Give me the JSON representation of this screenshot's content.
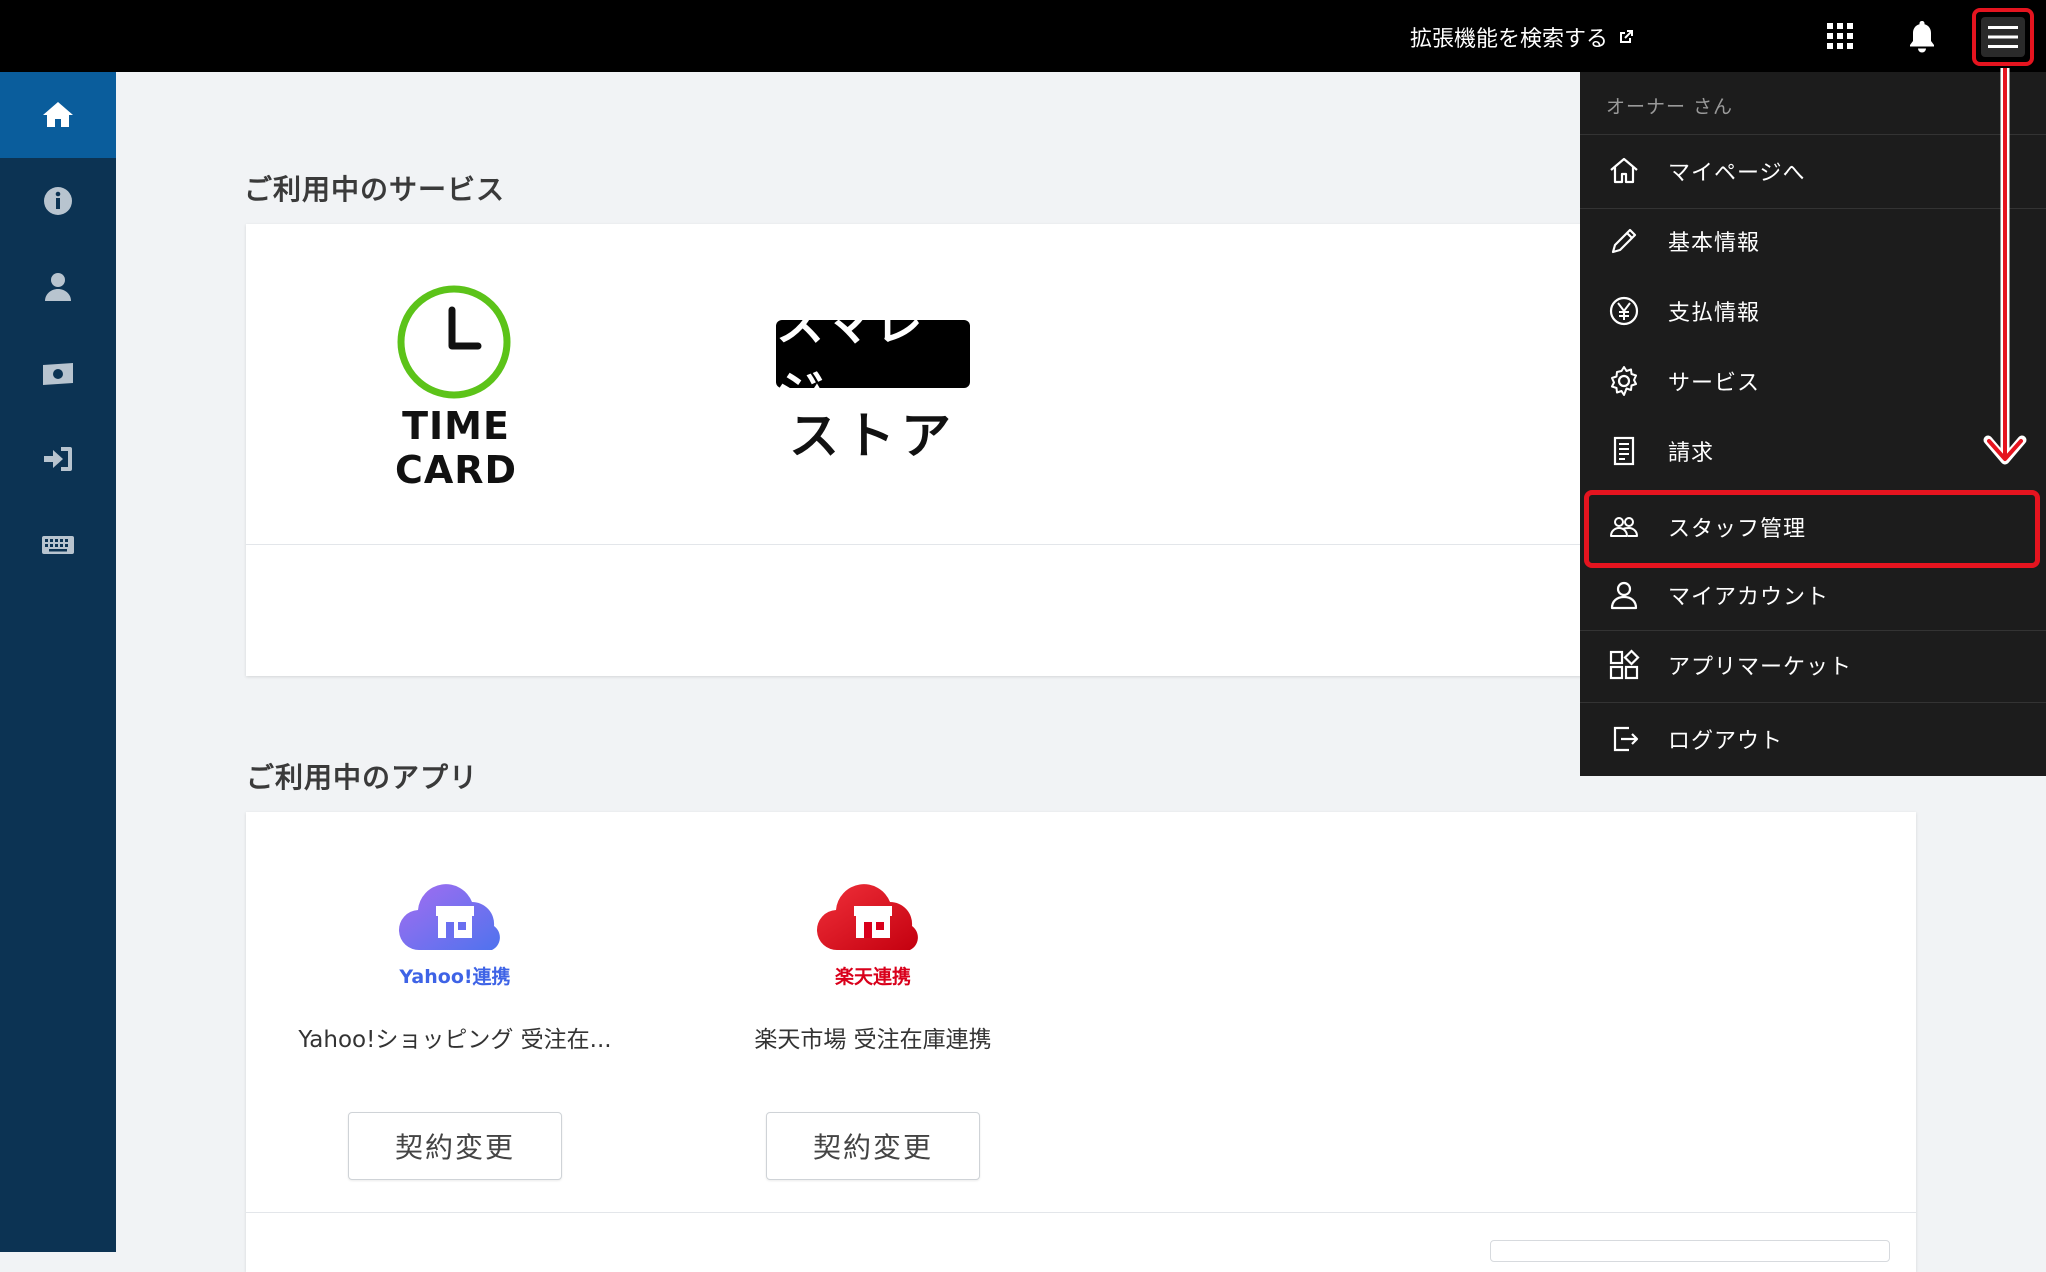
{
  "header": {
    "extension_link": "拡張機能を検索する",
    "icons": {
      "external": "external-link-icon",
      "apps": "apps-grid-icon",
      "bell": "bell-icon",
      "menu": "hamburger-menu-icon"
    }
  },
  "sidebar": {
    "items": [
      {
        "icon": "home-icon",
        "active": true
      },
      {
        "icon": "info-icon",
        "active": false
      },
      {
        "icon": "user-icon",
        "active": false
      },
      {
        "icon": "money-icon",
        "active": false
      },
      {
        "icon": "sign-in-icon",
        "active": false
      },
      {
        "icon": "keyboard-icon",
        "active": false
      }
    ]
  },
  "services": {
    "title": "ご利用中のサービス",
    "timecard_label": "TIME CARD",
    "smaregi_top": "スマレジ",
    "smaregi_bottom": "ストア"
  },
  "apps": {
    "title": "ご利用中のアプリ",
    "items": [
      {
        "logo_label": "Yahoo!連携",
        "name": "Yahoo!ショッピング 受注在...",
        "button": "契約変更",
        "color": "#5b6cf0"
      },
      {
        "logo_label": "楽天連携",
        "name": "楽天市場 受注在庫連携",
        "button": "契約変更",
        "color": "#d9001b"
      }
    ]
  },
  "dropdown": {
    "owner": "オーナー さん",
    "items": [
      {
        "label": "マイページへ",
        "icon": "home-outline-icon"
      },
      {
        "label": "基本情報",
        "icon": "pencil-icon"
      },
      {
        "label": "支払情報",
        "icon": "yen-icon"
      },
      {
        "label": "サービス",
        "icon": "gear-icon"
      },
      {
        "label": "請求",
        "icon": "document-icon"
      },
      {
        "label": "スタッフ管理",
        "icon": "staff-icon"
      },
      {
        "label": "マイアカウント",
        "icon": "person-outline-icon"
      },
      {
        "label": "アプリマーケット",
        "icon": "app-market-icon"
      },
      {
        "label": "ログアウト",
        "icon": "logout-icon"
      }
    ]
  },
  "colors": {
    "highlight": "#e5141f",
    "sidebar": "#0c3353",
    "sidebar_active": "#0a5d9c",
    "timecard_green": "#5cc319"
  }
}
